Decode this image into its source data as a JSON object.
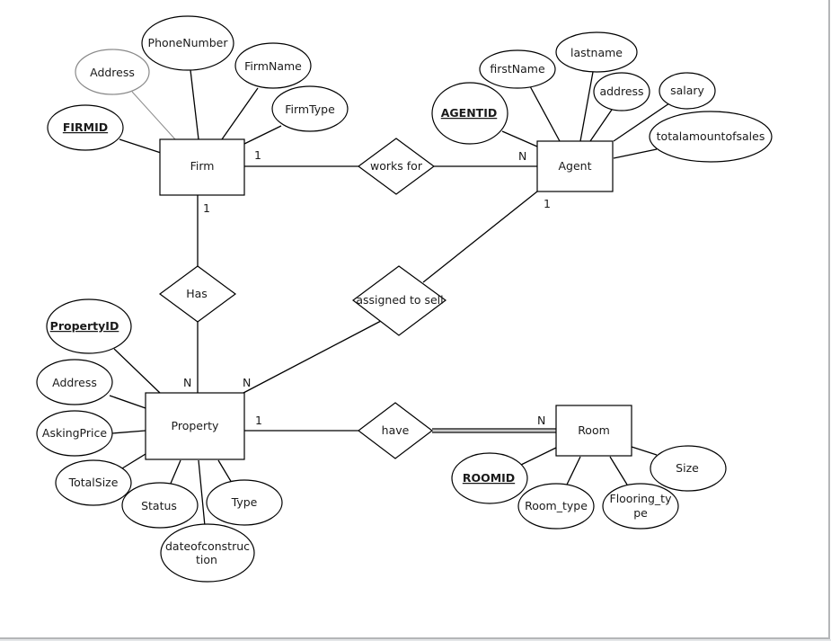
{
  "diagram": {
    "type": "ER diagram",
    "entities": [
      {
        "id": "firm",
        "label": "Firm"
      },
      {
        "id": "agent",
        "label": "Agent"
      },
      {
        "id": "property",
        "label": "Property"
      },
      {
        "id": "room",
        "label": "Room"
      }
    ],
    "relationships": [
      {
        "id": "works_for",
        "label": "works for",
        "from": "firm",
        "to": "agent",
        "from_card": "1",
        "to_card": "N"
      },
      {
        "id": "has",
        "label": "Has",
        "from": "firm",
        "to": "property",
        "from_card": "1",
        "to_card": "N"
      },
      {
        "id": "assigned_to_sell",
        "label": "assigned to sell",
        "from": "agent",
        "to": "property",
        "from_card": "1",
        "to_card": "N"
      },
      {
        "id": "have",
        "label": "have",
        "from": "property",
        "to": "room",
        "from_card": "1",
        "to_card": "N",
        "total_participation": "room"
      }
    ],
    "attributes": {
      "firm": [
        {
          "label": "FIRMID",
          "key": true
        },
        {
          "label": "Address",
          "key": false
        },
        {
          "label": "PhoneNumber",
          "key": false
        },
        {
          "label": "FirmName",
          "key": false
        },
        {
          "label": "FirmType",
          "key": false
        }
      ],
      "agent": [
        {
          "label": "AGENTID",
          "key": true
        },
        {
          "label": "firstName",
          "key": false
        },
        {
          "label": "lastname",
          "key": false
        },
        {
          "label": "address",
          "key": false
        },
        {
          "label": "salary",
          "key": false
        },
        {
          "label": "totalamountofsales",
          "key": false
        }
      ],
      "property": [
        {
          "label": "PropertyID",
          "key": true
        },
        {
          "label": "Address",
          "key": false
        },
        {
          "label": "AskingPrice",
          "key": false
        },
        {
          "label": "TotalSize",
          "key": false
        },
        {
          "label": "Status",
          "key": false
        },
        {
          "label": "dateofconstruction",
          "key": false,
          "lines": [
            "dateofconstruc",
            "tion"
          ]
        },
        {
          "label": "Type",
          "key": false
        }
      ],
      "room": [
        {
          "label": "ROOMID",
          "key": true
        },
        {
          "label": "Room_type",
          "key": false
        },
        {
          "label": "Flooring_type",
          "key": false,
          "lines": [
            "Flooring_ty",
            "pe"
          ]
        },
        {
          "label": "Size",
          "key": false
        }
      ]
    }
  }
}
